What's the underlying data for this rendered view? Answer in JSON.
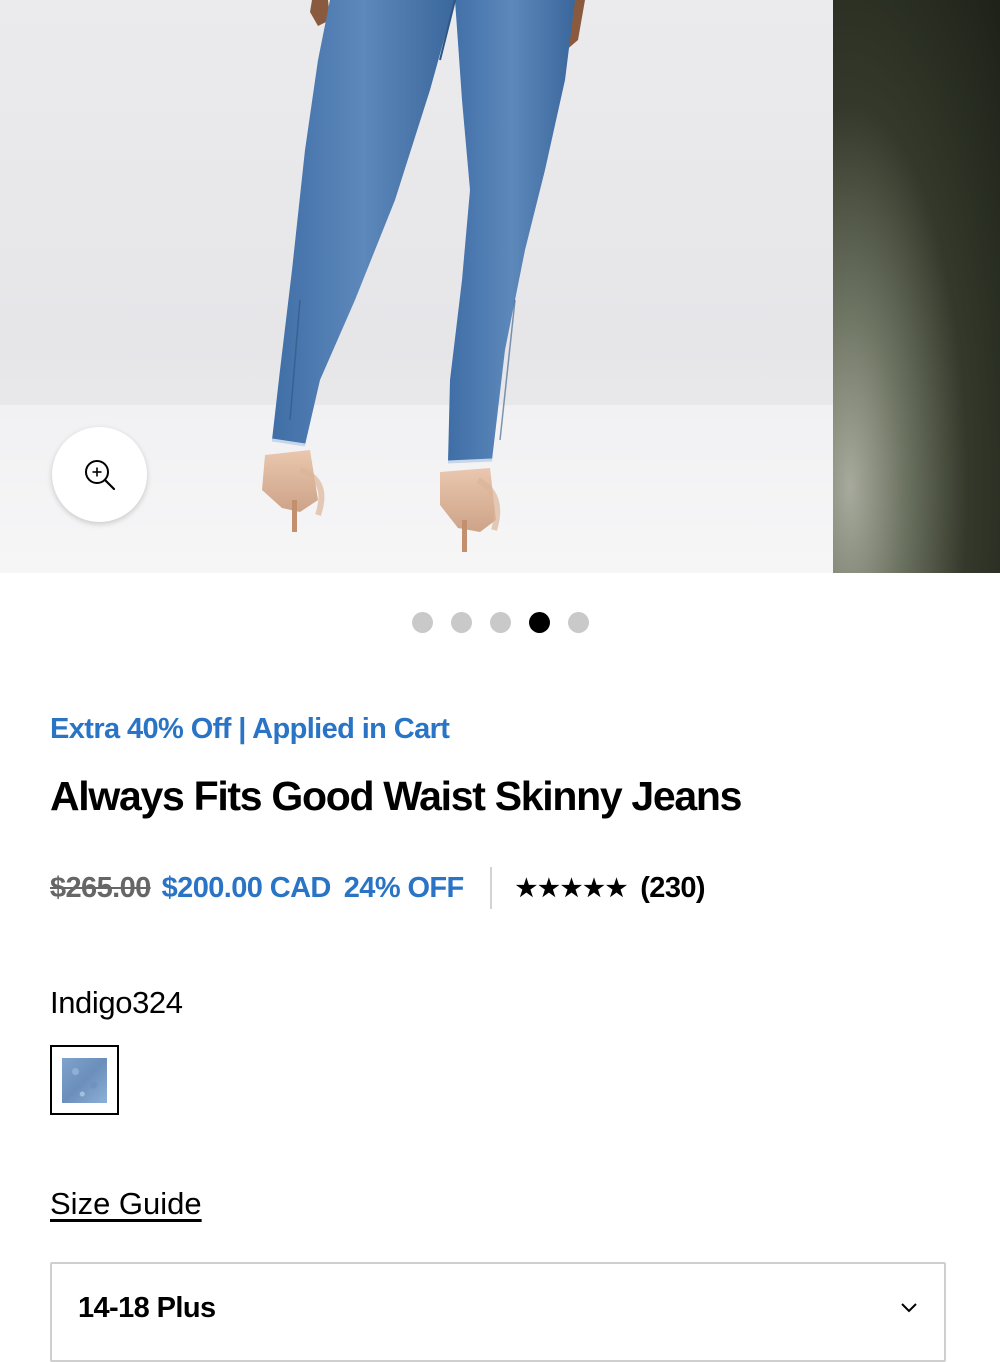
{
  "gallery": {
    "zoom_icon": "zoom-in-icon",
    "dots_total": 5,
    "active_index": 4
  },
  "product": {
    "promo": "Extra 40% Off | Applied in Cart",
    "title": "Always Fits Good Waist Skinny Jeans",
    "price_original": "$265.00",
    "price_sale": "$200.00 CAD",
    "discount": "24% OFF",
    "rating_stars": "★★★★★",
    "review_count": "(230)",
    "color_name": "Indigo324",
    "size_guide_label": "Size Guide",
    "selected_size": "14-18 Plus",
    "size_chevron_icon": "chevron-down-icon"
  },
  "colors": {
    "accent_blue": "#2a74c6",
    "dot_inactive": "#c9c9c9",
    "dot_active": "#000000"
  }
}
